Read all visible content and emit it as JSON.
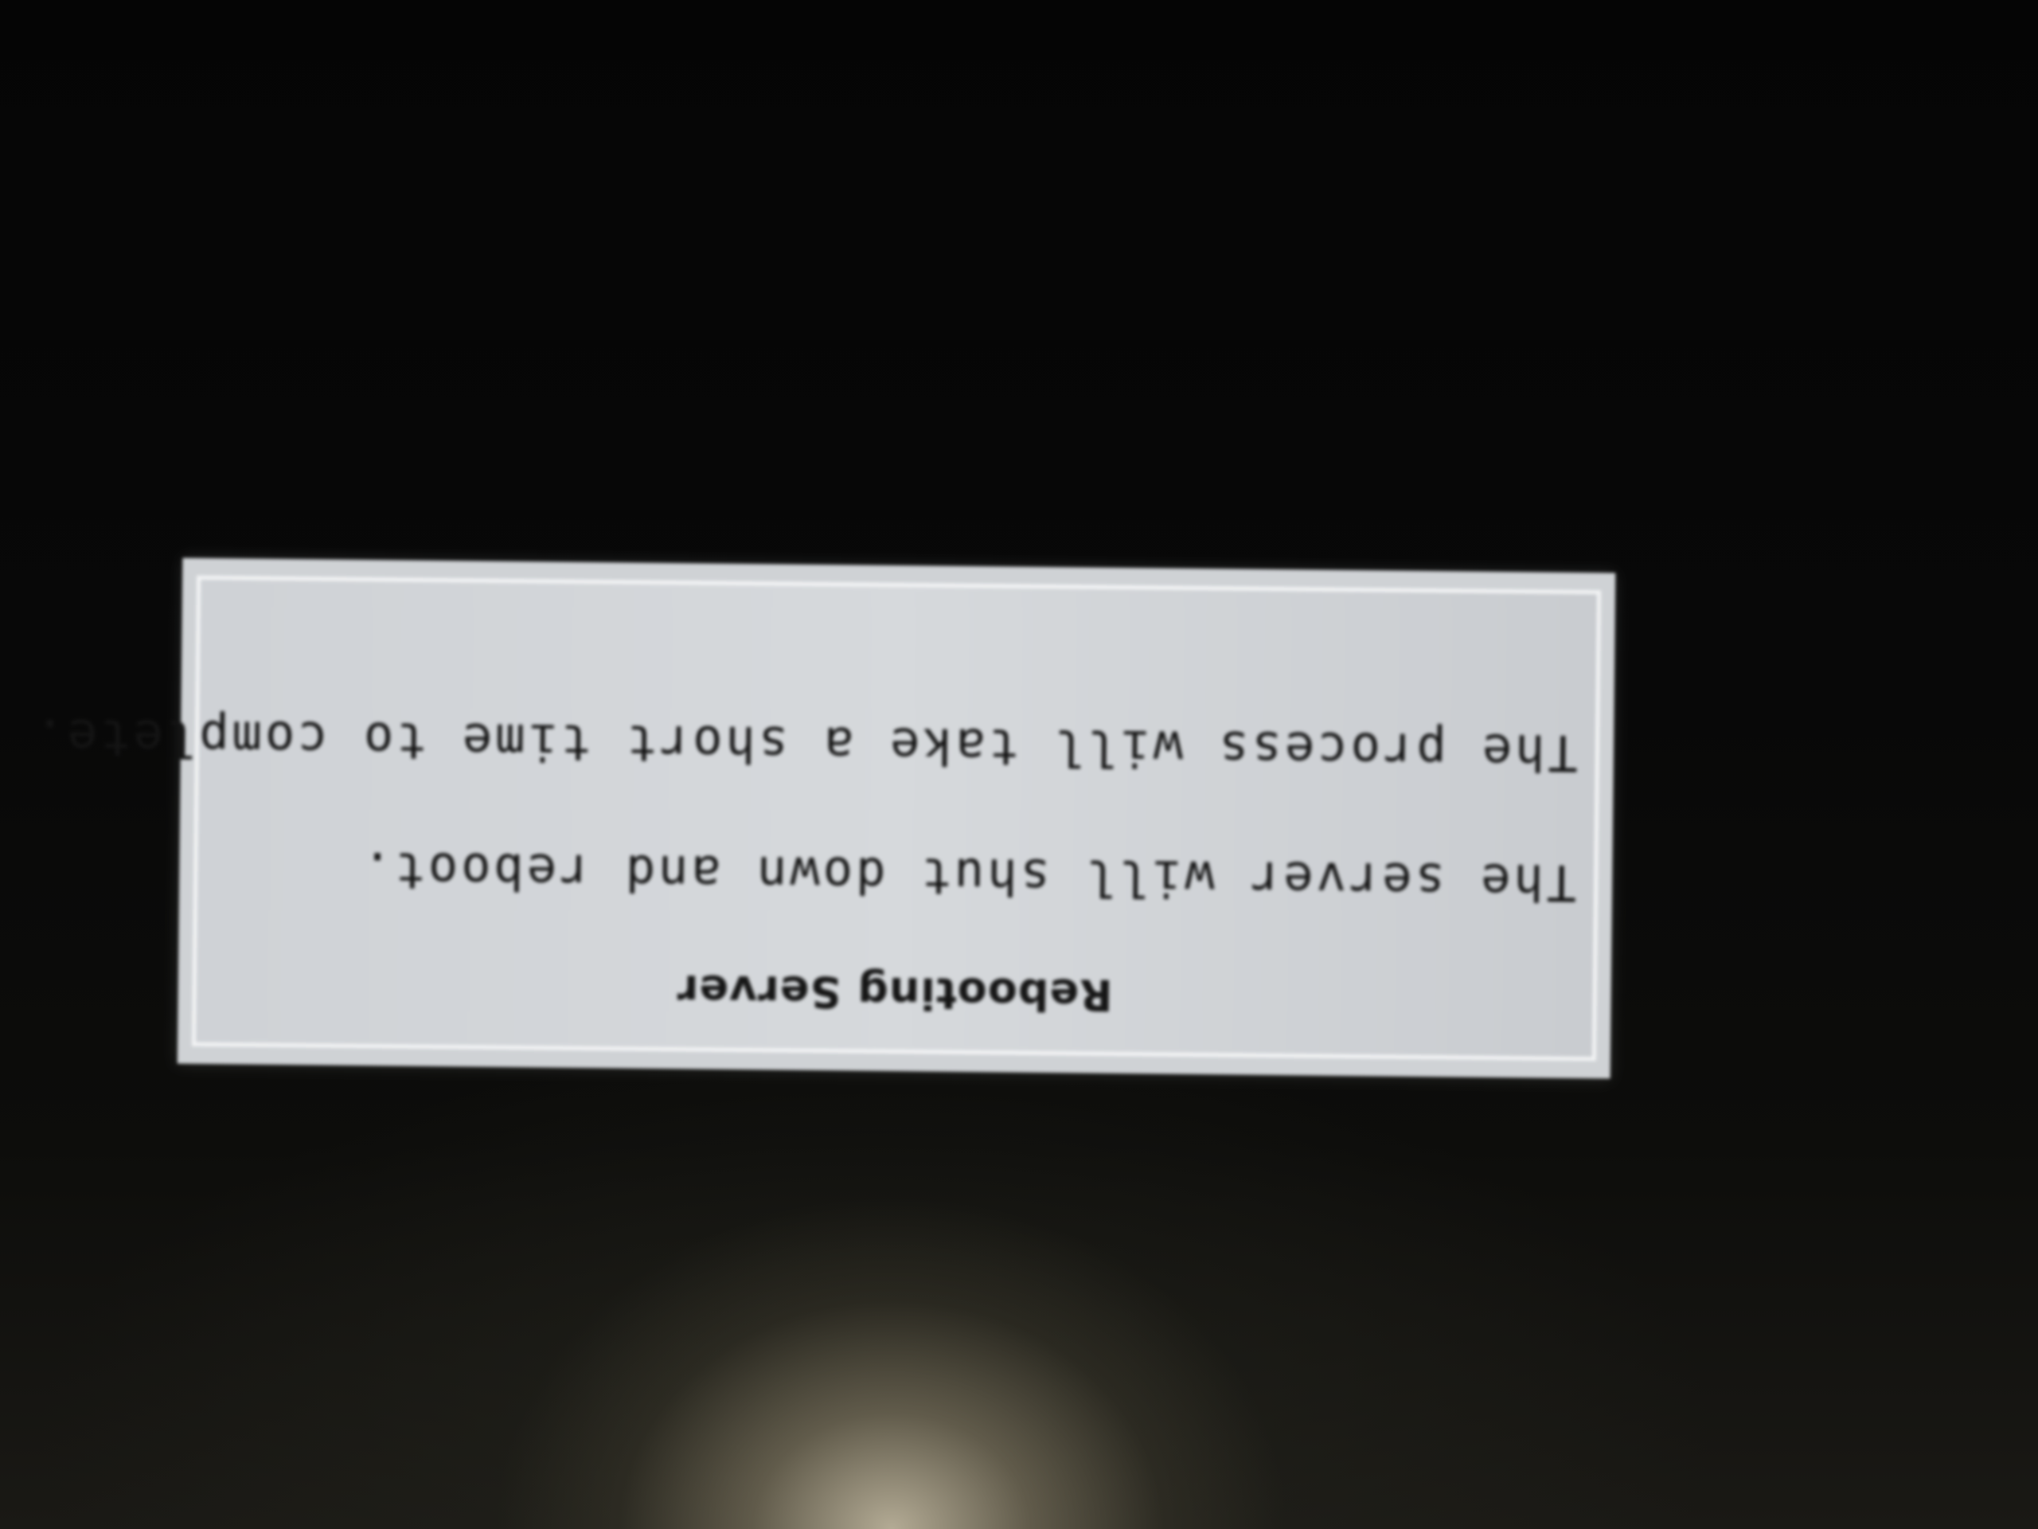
{
  "dialog": {
    "title": "Rebooting Server",
    "lines": [
      "The server will shut down and reboot.",
      "The process will take a short time to complete."
    ]
  },
  "colors": {
    "background": "#060606",
    "dialog_face": "#cfd2d5",
    "dialog_border": "#f3f4f5",
    "text": "#141414"
  }
}
